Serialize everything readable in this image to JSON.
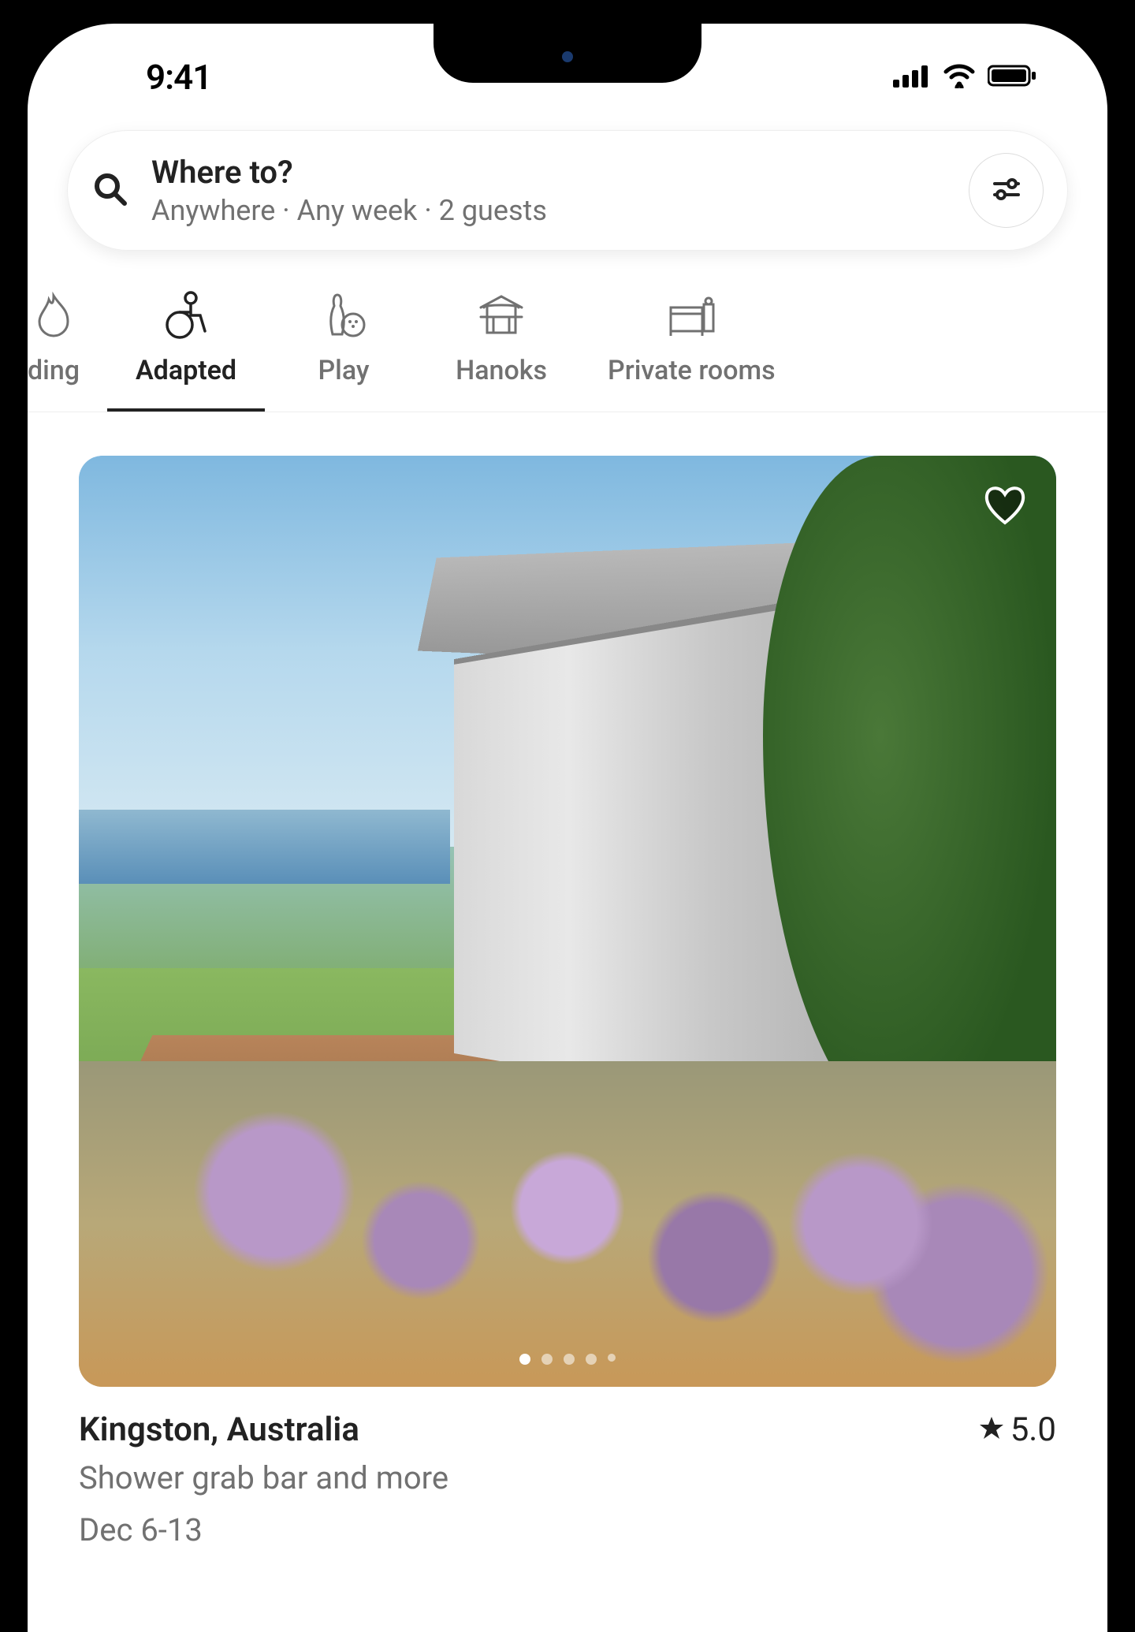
{
  "statusBar": {
    "time": "9:41"
  },
  "search": {
    "title": "Where to?",
    "subtitle": "Anywhere · Any week · 2 guests"
  },
  "categories": {
    "items": [
      {
        "label": "ding",
        "icon": "fire-icon",
        "active": false,
        "partial": true
      },
      {
        "label": "Adapted",
        "icon": "wheelchair-icon",
        "active": true,
        "partial": false
      },
      {
        "label": "Play",
        "icon": "bowling-icon",
        "active": false,
        "partial": false
      },
      {
        "label": "Hanoks",
        "icon": "hanok-icon",
        "active": false,
        "partial": false
      },
      {
        "label": "Private rooms",
        "icon": "bedroom-icon",
        "active": false,
        "partial": false
      }
    ]
  },
  "listing": {
    "title": "Kingston, Australia",
    "rating": "5.0",
    "features": "Shower grab bar and more",
    "dates": "Dec 6-13",
    "carousel": {
      "total": 5,
      "active": 0
    }
  }
}
